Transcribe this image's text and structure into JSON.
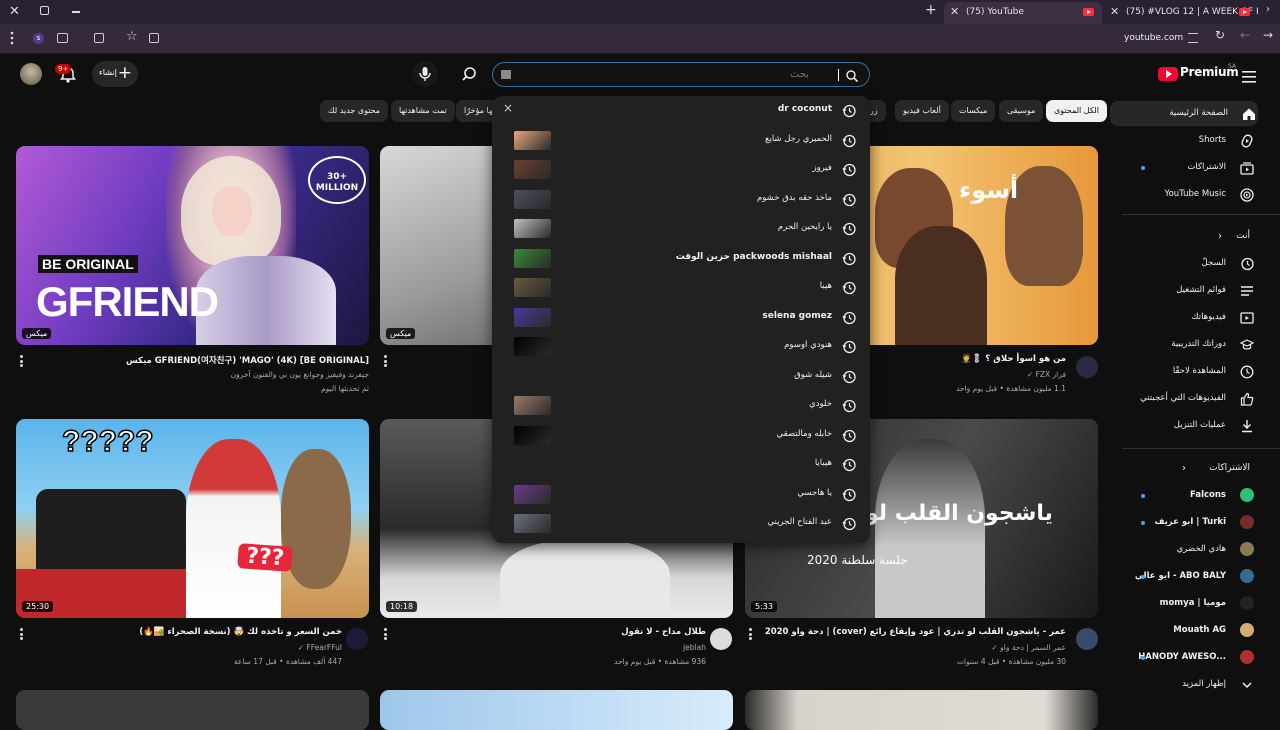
{
  "browser": {
    "tabs": [
      {
        "title": "(75) YouTube",
        "active": true
      },
      {
        "title": "(75) #VLOG 12 | A WEEK OF FU",
        "active": false
      }
    ],
    "url": "youtube.com"
  },
  "header": {
    "logo_text": "Premium",
    "logo_sup": "SA",
    "create_label": "إنشاء",
    "notif_count": "9+",
    "search_value": "",
    "search_placeholder": "بحث"
  },
  "chips": [
    "الكل المحتوى",
    "موسيقى",
    "ميكسات",
    "ألعاب فيديو",
    "زر",
    "تم تحميلها مؤخرًا",
    "تمت مشاهدتها",
    "محتوى جديد لك"
  ],
  "sidebar": {
    "main": [
      "الصفحة الرئيسية",
      "Shorts",
      "الاشتراكات",
      "YouTube Music"
    ],
    "you_header": "أنت",
    "you": [
      "السجلّ",
      "قوائم التشغيل",
      "فيديوهاتك",
      "دوراتك التدريبية",
      "المشاهدة لاحقًا",
      "الفيديوهات التي أعجبتني",
      "عمليات التنزيل"
    ],
    "subs_header": "الاشتراكات",
    "subs": [
      "Falcons",
      "ابو عريف | Turki",
      "هادي الخضري",
      "ابو عالي - ABO BALY",
      "momya | مومیا",
      "Mouath AG",
      "HANODY AWESO..."
    ],
    "show_more": "إظهار المزيد"
  },
  "suggestions": [
    {
      "text": "dr coconut",
      "bold": true,
      "thumb": false,
      "remove": "×"
    },
    {
      "text": "الحميري رجل شايع",
      "bold": false,
      "thumb": true
    },
    {
      "text": "فيروز",
      "bold": false,
      "thumb": true
    },
    {
      "text": "ماخذ حقه بدق خشوم",
      "bold": false,
      "thumb": true
    },
    {
      "text": "يا رايحين الحرم",
      "bold": false,
      "thumb": true
    },
    {
      "text": "packwoods mishaal حزين الوقت",
      "bold": true,
      "thumb": true
    },
    {
      "text": "هيبا",
      "bold": false,
      "thumb": true
    },
    {
      "text": "selena gomez",
      "bold": true,
      "thumb": true
    },
    {
      "text": "هنودي اوسوم",
      "bold": false,
      "thumb": true
    },
    {
      "text": "شيله شوق",
      "bold": false,
      "thumb": false
    },
    {
      "text": "خلودي",
      "bold": false,
      "thumb": true
    },
    {
      "text": "خابله ومالتصقي",
      "bold": false,
      "thumb": true
    },
    {
      "text": "هيبايا",
      "bold": false,
      "thumb": false
    },
    {
      "text": "يا هاجسي",
      "bold": false,
      "thumb": true
    },
    {
      "text": "عبد الفتاح الجريني",
      "bold": false,
      "thumb": true
    }
  ],
  "videos": [
    {
      "title": "GFRIEND(여자친구) 'MAGO' (4K) [BE ORIGINAL] ميكس",
      "meta1": "جيفرند وفيفيز وجوانغ يون بي والفنون آخرون",
      "meta2": "تم تحديثها اليوم",
      "badge": "ميكس",
      "thumb_text1": "BE ORIGINAL",
      "thumb_text2": "GFRIEND",
      "thumb_badge": "30+ MILLION"
    },
    {
      "title": "",
      "meta1": "",
      "meta2": "",
      "badge": "ميكس"
    },
    {
      "title": "من هو اسوأ حلاق ؟ 💈🤵",
      "meta1": "فراز FZX ✓",
      "meta2": "1.1 مليون مشاهدة • قبل يوم واحد",
      "badge": "",
      "thumb_text1": "أسوء"
    },
    {
      "title": "خمن السعر و تاخذه لك 🤯 (نسخة الصحراء 🏜️🔥)",
      "meta1": "FFearFFul ✓",
      "meta2": "447 ألف مشاهدة • قبل 17 ساعة",
      "badge": "25:30",
      "thumb_text1": "?????",
      "thumb_text2": "???"
    },
    {
      "title": "طلال مداح - لا تقول",
      "meta1": "jeblah",
      "meta2": "936 مشاهدة • قبل يوم واحد",
      "badge": "10:18"
    },
    {
      "title": "عمر - ياشجون القلب لو تدري | عود وإيقاع رائع (cover) | دحة واو 2020",
      "meta1": "عمر السمر | دحة واو ✓",
      "meta2": "30 مليون مشاهدة • قبل 4 سنوات",
      "badge": "5:33",
      "thumb_text1": "ياشجون القلب لو",
      "thumb_text2": "جلسة سلطنة 2020"
    }
  ],
  "colors": {
    "accent": "#3ea6ff",
    "brand": "#ff0033",
    "bg": "#0f0f0f",
    "dropdown": "#212121"
  }
}
